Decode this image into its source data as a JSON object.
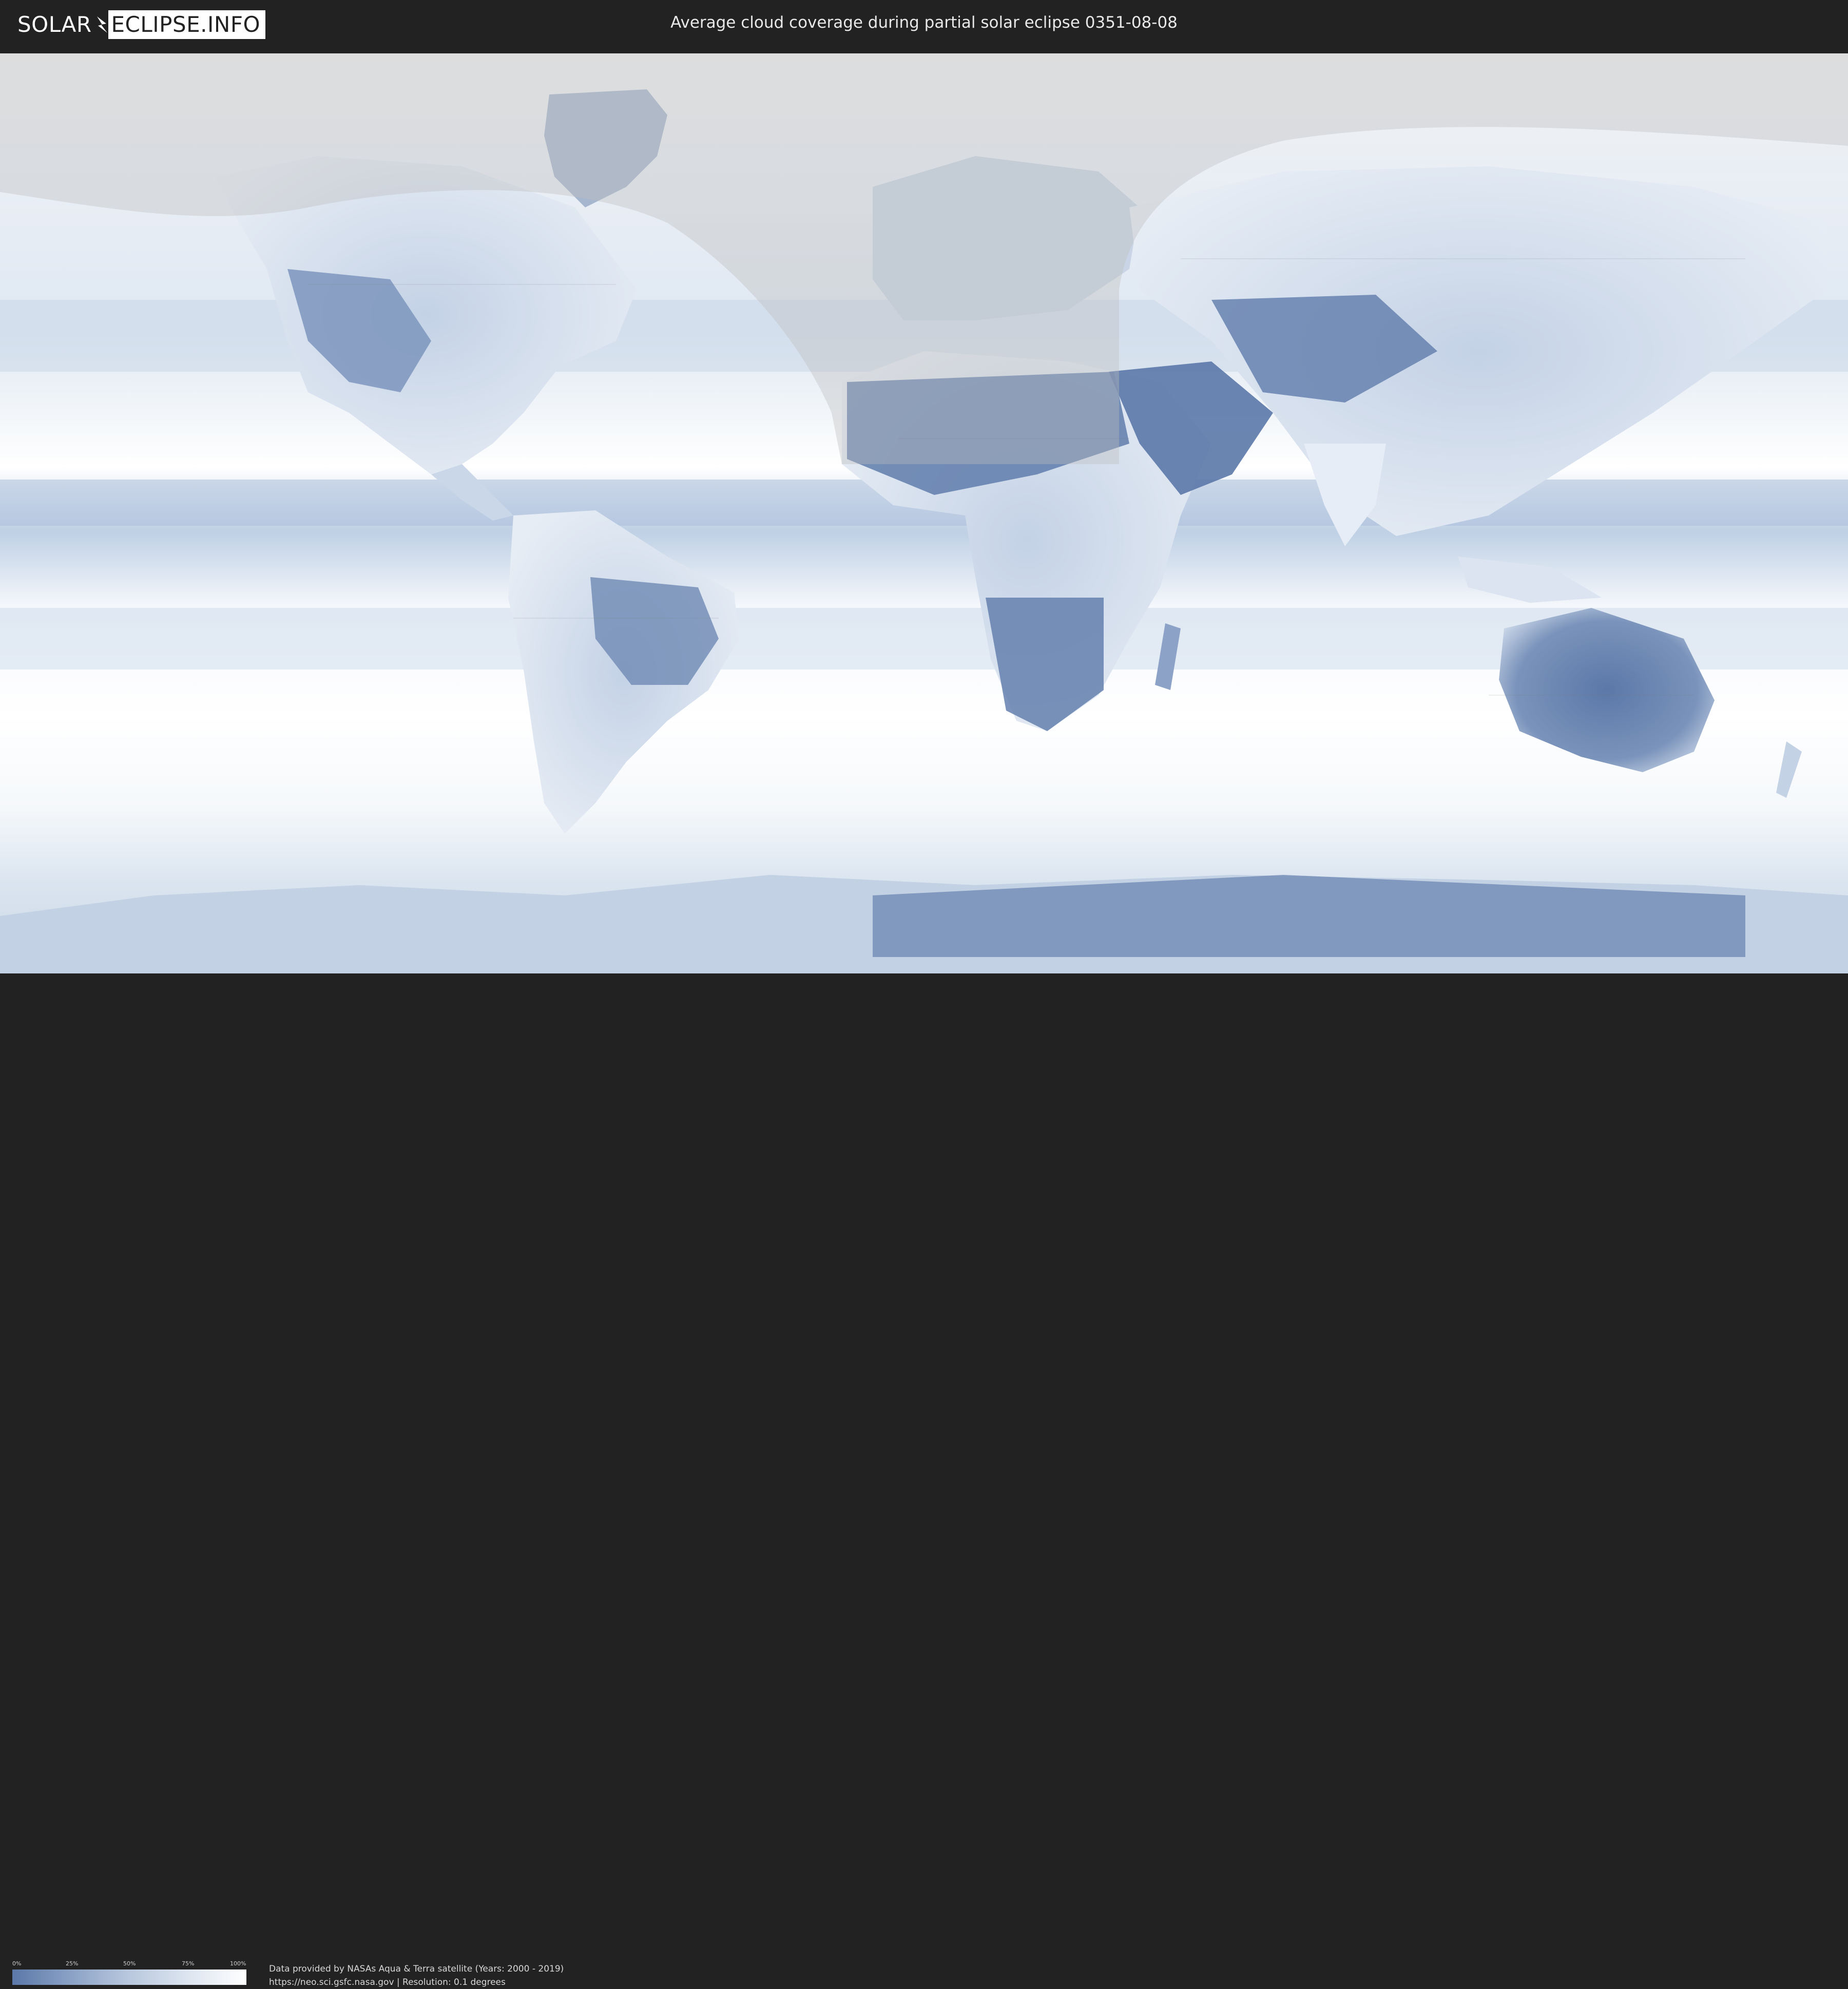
{
  "header": {
    "logo_left": "SOLAR",
    "logo_right": "ECLIPSE.INFO",
    "title": "Average cloud coverage during partial solar eclipse 0351-08-08"
  },
  "map": {
    "ocean_color": "#eef2f8",
    "land_clear_color": "#5b78a8",
    "shadow_overlay_color": "#bfbfbf"
  },
  "legend": {
    "ticks": [
      "0%",
      "25%",
      "50%",
      "75%",
      "100%"
    ],
    "gradient_start": "#5b78a8",
    "gradient_end": "#ffffff"
  },
  "footer": {
    "line1": "Data provided by NASAs Aqua & Terra satellite (Years: 2000 - 2019)",
    "line2": "https://neo.sci.gsfc.nasa.gov | Resolution: 0.1 degrees"
  }
}
